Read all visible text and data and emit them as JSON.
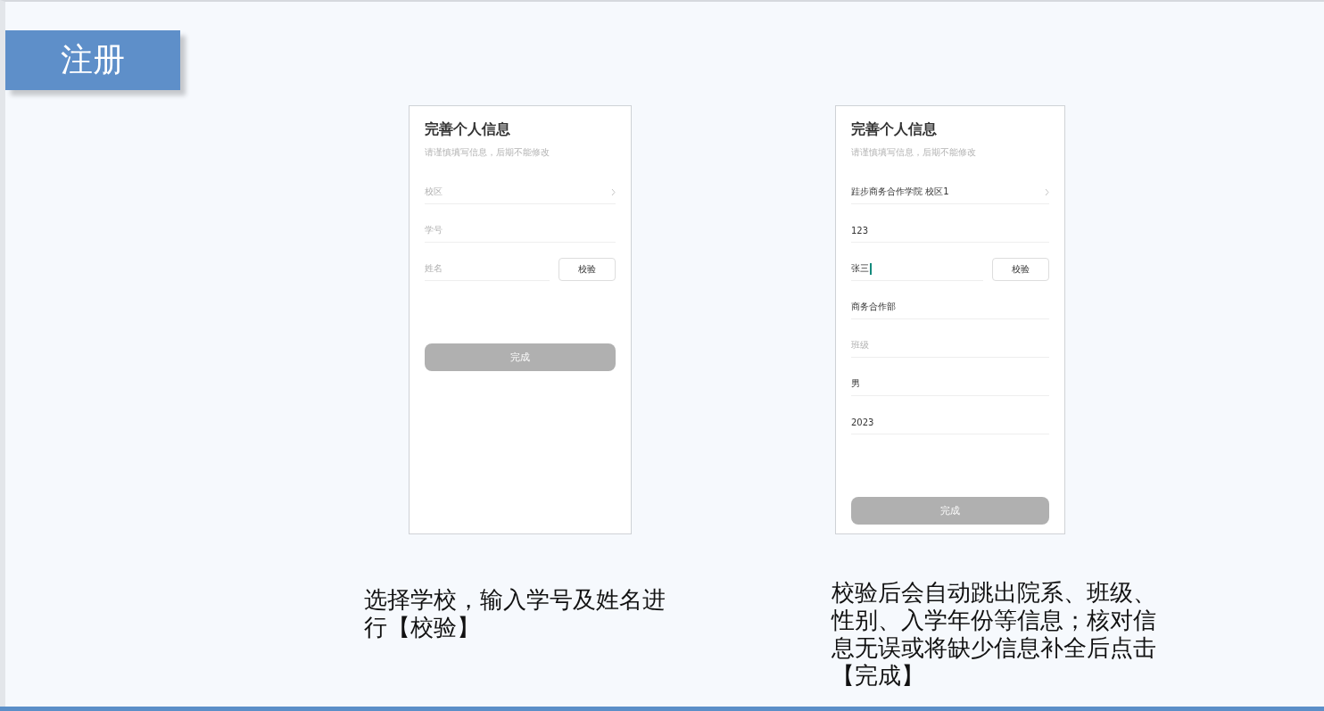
{
  "title": "注册",
  "screens": [
    {
      "title": "完善个人信息",
      "subtitle": "请谨慎填写信息，后期不能修改",
      "fields": [
        {
          "kind": "select",
          "placeholder": "校区"
        },
        {
          "kind": "text",
          "placeholder": "学号"
        },
        {
          "kind": "verify",
          "placeholder": "姓名",
          "button": "校验",
          "focused": false
        }
      ],
      "submit": "完成"
    },
    {
      "title": "完善个人信息",
      "subtitle": "请谨慎填写信息，后期不能修改",
      "fields": [
        {
          "kind": "select",
          "value": "跬步商务合作学院 校区1"
        },
        {
          "kind": "text",
          "value": "123"
        },
        {
          "kind": "verify",
          "value": "张三",
          "button": "校验",
          "focused": true
        },
        {
          "kind": "text",
          "value": "商务合作部"
        },
        {
          "kind": "text",
          "placeholder": "班级"
        },
        {
          "kind": "text",
          "value": "男"
        },
        {
          "kind": "text",
          "value": "2023"
        }
      ],
      "submit": "完成"
    }
  ],
  "captions": [
    "选择学校，输入学号及姓名进行【校验】",
    "校验后会自动跳出院系、班级、性别、入学年份等信息；核对信息无误或将缺少信息补全后点击【完成】"
  ]
}
